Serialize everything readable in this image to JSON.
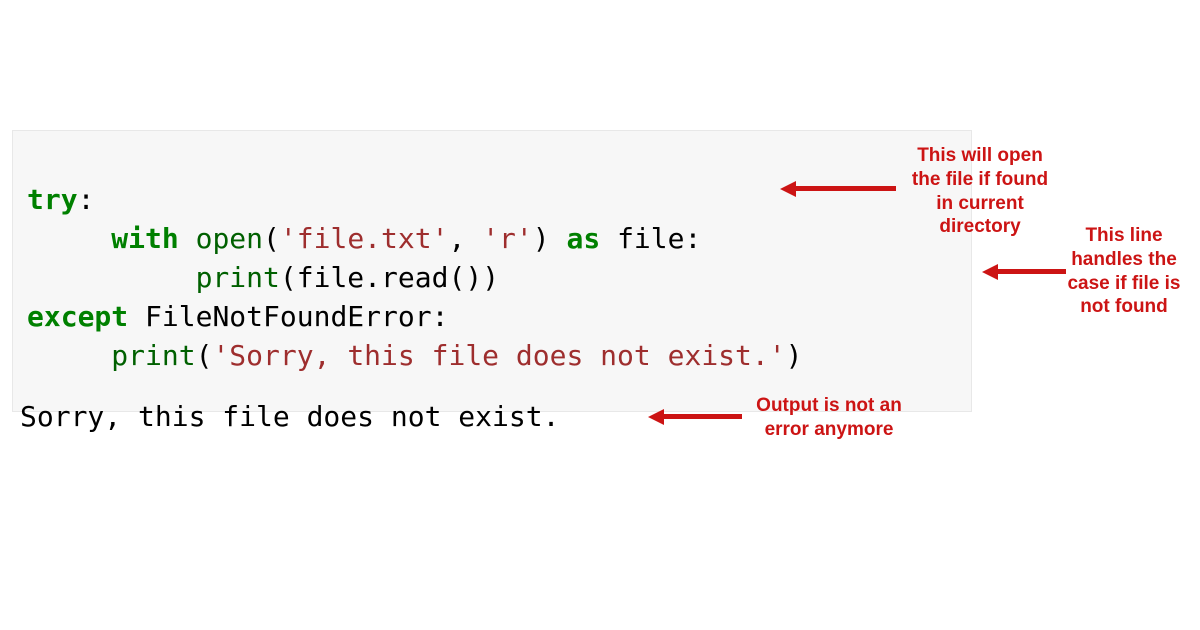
{
  "code": {
    "line1": {
      "try": "try",
      "colon": ":"
    },
    "line2": {
      "indent": "     ",
      "with": "with",
      "sp1": " ",
      "open": "open",
      "lp": "(",
      "arg1": "'file.txt'",
      "comma": ", ",
      "arg2": "'r'",
      "rp": ")",
      "sp2": " ",
      "as": "as",
      "sp3": " ",
      "file": "file",
      "colon": ":"
    },
    "line3": {
      "indent": "          ",
      "print": "print",
      "lp": "(",
      "file": "file",
      "dot": ".",
      "read": "read",
      "lp2": "(",
      "rp2": ")",
      "rp": ")"
    },
    "line4": {
      "except": "except",
      "sp": " ",
      "err": "FileNotFoundError",
      "colon": ":"
    },
    "line5": {
      "indent": "     ",
      "print": "print",
      "lp": "(",
      "msg": "'Sorry, this file does not exist.'",
      "rp": ")"
    }
  },
  "output": "Sorry, this file does not exist.",
  "annotations": {
    "a1": "This will open\nthe file if found\nin current\ndirectory",
    "a2": "This line\nhandles the\ncase if file is\nnot found",
    "a3": "Output is not an\nerror anymore"
  },
  "colors": {
    "annotation": "#cc1414",
    "keyword": "#008000",
    "string": "#9e2e2e",
    "code_bg": "#f7f7f7"
  }
}
